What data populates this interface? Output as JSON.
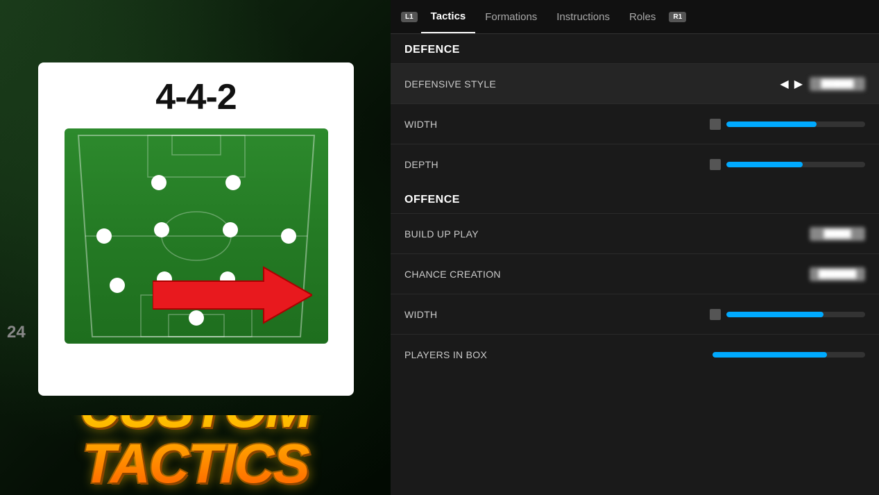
{
  "left": {
    "formation": "4-4-2",
    "custom_tactics_label": "CUSTOM TACTICS"
  },
  "right": {
    "nav": {
      "l1_badge": "L1",
      "r1_badge": "R1",
      "tabs": [
        {
          "id": "tactics",
          "label": "Tactics",
          "active": true
        },
        {
          "id": "formations",
          "label": "Formations",
          "active": false
        },
        {
          "id": "instructions",
          "label": "Instructions",
          "active": false
        },
        {
          "id": "roles",
          "label": "Roles",
          "active": false
        }
      ]
    },
    "defence_header": "DEFENCE",
    "offence_header": "OFFENCE",
    "settings": [
      {
        "id": "defensive-style",
        "label": "DEFENSIVE STYLE",
        "type": "selector",
        "value": "BLURRED"
      },
      {
        "id": "width-defence",
        "label": "WIDTH",
        "type": "slider",
        "fill_percent": 65
      },
      {
        "id": "depth",
        "label": "DEPTH",
        "type": "slider",
        "fill_percent": 55
      },
      {
        "id": "build-up-play",
        "label": "BUILD UP PLAY",
        "type": "badge",
        "value": "BLURRED"
      },
      {
        "id": "chance-creation",
        "label": "CHANCE CREATION",
        "type": "badge",
        "value": "BLURRED"
      },
      {
        "id": "width-offence",
        "label": "WIDTH",
        "type": "slider",
        "fill_percent": 70
      },
      {
        "id": "players-in-box",
        "label": "PLAYERS IN BOX",
        "type": "slider-only",
        "fill_percent": 75
      }
    ]
  },
  "year": "24"
}
